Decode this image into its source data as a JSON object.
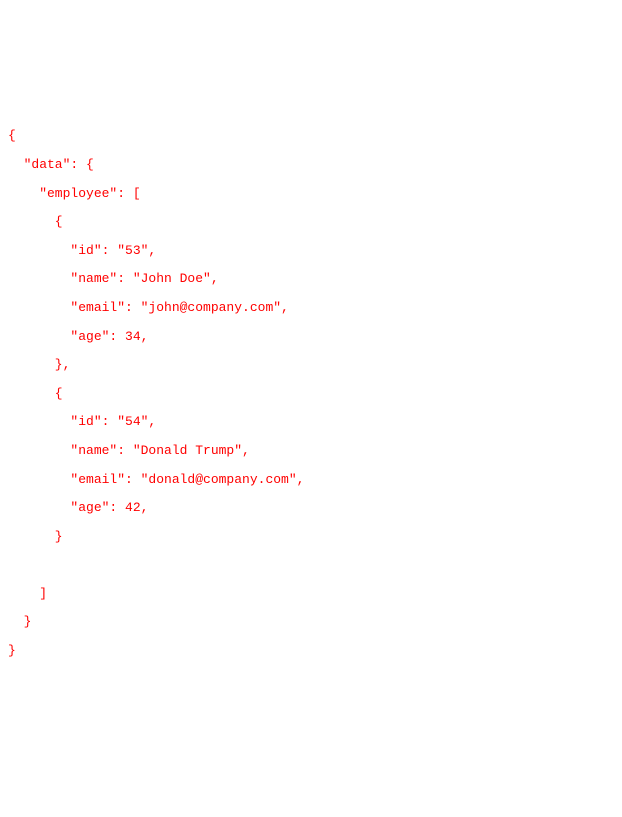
{
  "code_text": "{\n  \"data\": {\n    \"employee\": [\n      {\n        \"id\": \"53\",\n        \"name\": \"John Doe\",\n        \"email\": \"john@company.com\",\n        \"age\": 34,\n      },\n      {\n        \"id\": \"54\",\n        \"name\": \"Donald Trump\",\n        \"email\": \"donald@company.com\",\n        \"age\": 42,\n      }\n\n    ]\n  }\n}"
}
